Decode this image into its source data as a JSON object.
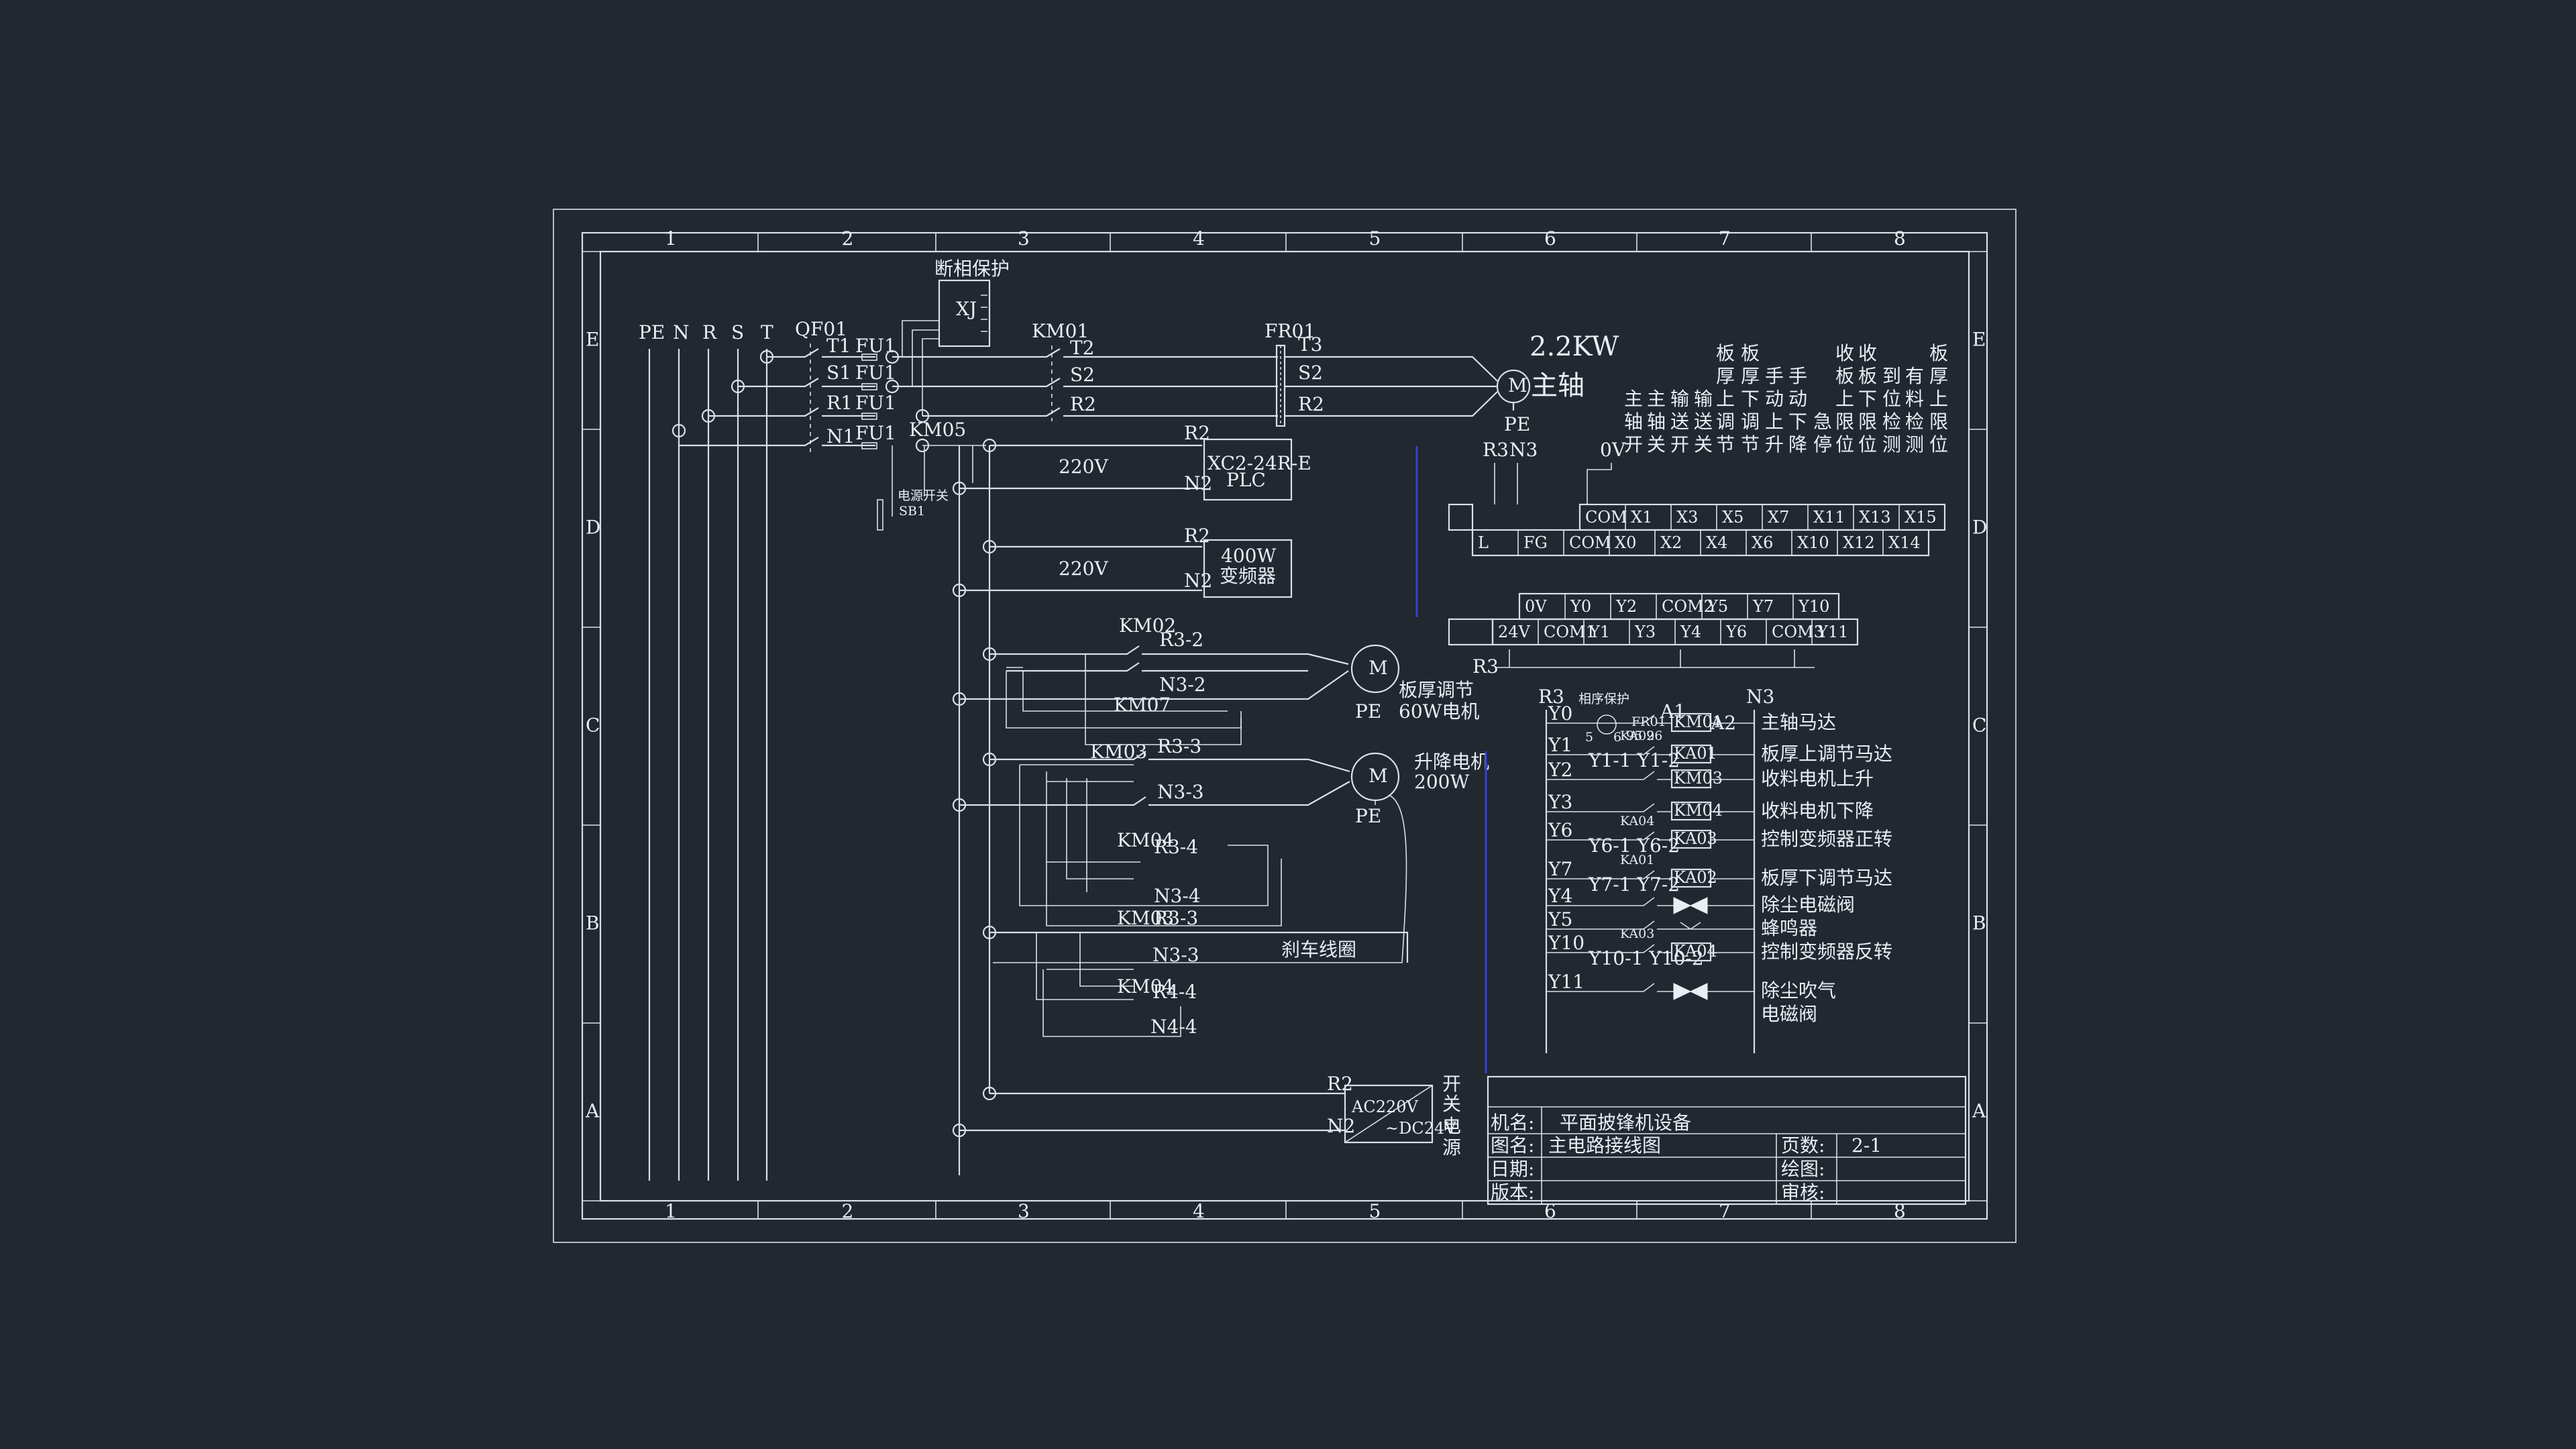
{
  "columns": [
    "1",
    "2",
    "3",
    "4",
    "5",
    "6",
    "7",
    "8"
  ],
  "rows": [
    "E",
    "D",
    "C",
    "B",
    "A"
  ],
  "supply": {
    "labels": [
      "PE",
      "N",
      "R",
      "S",
      "T"
    ],
    "breaker": "QF01"
  },
  "phases": {
    "in": [
      "T1",
      "S1",
      "R1",
      "N1"
    ],
    "fuse": "FU1",
    "out": [
      "T2",
      "S2",
      "R2"
    ],
    "out3": [
      "T3",
      "S2",
      "R2"
    ]
  },
  "devices": {
    "phase_protect": "断相保护",
    "xj": "XJ",
    "km01": "KM01",
    "fr01": "FR01",
    "motor_main_power": "2.2KW",
    "motor_main_name": "主轴",
    "pe": "PE",
    "motor_m": "M",
    "km05": "KM05",
    "switch_label": "电源开关",
    "sb1": "SB1",
    "v220": "220V",
    "r2": "R2",
    "n2": "N2",
    "l": "L",
    "n": "N",
    "plc_model": "XC2-24R-E",
    "plc": "PLC",
    "vfd_power": "400W",
    "vfd_name": "变频器",
    "r3": "R3",
    "n3": "N3",
    "ov": "0V",
    "com": "COM",
    "fg": "FG",
    "km02": "KM02",
    "km07": "KM07",
    "km03": "KM03",
    "km04": "KM04",
    "r3_2": "R3-2",
    "n3_2": "N3-2",
    "r3_3": "R3-3",
    "n3_3": "N3-3",
    "r3_4": "R3-4",
    "n3_4": "N3-4",
    "r4_4": "R4-4",
    "n4_4": "N4-4",
    "motor_thick_name": "板厚调节",
    "motor_thick_power": "60W电机",
    "motor_lift_name": "升降电机",
    "motor_lift_power": "200W",
    "brake_coil": "刹车线圈",
    "psu_in": "AC220V",
    "psu_out": "~DC24V",
    "psu_label": [
      "开",
      "关",
      "电",
      "源"
    ]
  },
  "plc_inputs_top": [
    "COM",
    "X1",
    "X3",
    "X5",
    "X7",
    "X11",
    "X13",
    "X15"
  ],
  "plc_inputs_bottom": [
    "L",
    "FG",
    "COM",
    "X0",
    "X2",
    "X4",
    "X6",
    "X10",
    "X12",
    "X14"
  ],
  "plc_outputs_top": [
    "0V",
    "Y0",
    "Y2",
    "COM2",
    "Y5",
    "Y7",
    "Y10"
  ],
  "plc_outputs_bottom": [
    "24V",
    "COM1",
    "Y1",
    "Y3",
    "Y4",
    "Y6",
    "COM3",
    "Y11"
  ],
  "input_labels": [
    "主轴开",
    "主轴关",
    "输送开",
    "输送关",
    "板厚上调节",
    "板厚下调节",
    "手动上升",
    "手动下降",
    "急停",
    "收板上限位",
    "收板下限位",
    "到位检测",
    "有料检测",
    "板厚上限位"
  ],
  "outputs": {
    "header_r3": "R3",
    "header_n3": "N3",
    "phase_seq": "相序保护",
    "fr01_contacts": "95  96",
    "a1": "A1",
    "a2": "A2",
    "c5": "5",
    "c6": "6",
    "rows": [
      {
        "y": "Y0",
        "coil": "KM01",
        "desc": "主轴马达"
      },
      {
        "y": "Y1",
        "ka": "KA02",
        "sw": "Y1-1  Y1-2",
        "coil": "KA01",
        "desc": "板厚上调节马达"
      },
      {
        "y": "Y2",
        "coil": "KM03",
        "desc": "收料电机上升"
      },
      {
        "y": "Y3",
        "coil": "KM04",
        "desc": "收料电机下降"
      },
      {
        "y": "Y6",
        "ka": "KA04",
        "sw": "Y6-1  Y6-2",
        "coil": "KA03",
        "desc": "控制变频器正转"
      },
      {
        "y": "Y7",
        "ka": "KA01",
        "sw": "Y7-1  Y7-2",
        "coil": "KA02",
        "desc": "板厚下调节马达"
      },
      {
        "y": "Y4",
        "desc": "除尘电磁阀"
      },
      {
        "y": "Y5",
        "desc": "蜂鸣器"
      },
      {
        "y": "Y10",
        "ka": "KA03",
        "sw": "Y10-1 Y10-2",
        "coil": "KA04",
        "desc": "控制变频器反转"
      },
      {
        "y": "Y11",
        "desc": "除尘吹气",
        "desc2": "电磁阀"
      }
    ]
  },
  "title_block": {
    "machine_label": "机名:",
    "machine": "平面披锋机设备",
    "drawing_label": "图名:",
    "drawing": "主电路接线图",
    "page_label": "页数:",
    "page": "2-1",
    "date_label": "日期:",
    "draw_label": "绘图:",
    "version_label": "版本:",
    "review_label": "审核:"
  },
  "colors": {
    "background": "#212830",
    "line": "#d9e1e8",
    "text": "#e8eef4",
    "accent": "#3a3fd0"
  }
}
